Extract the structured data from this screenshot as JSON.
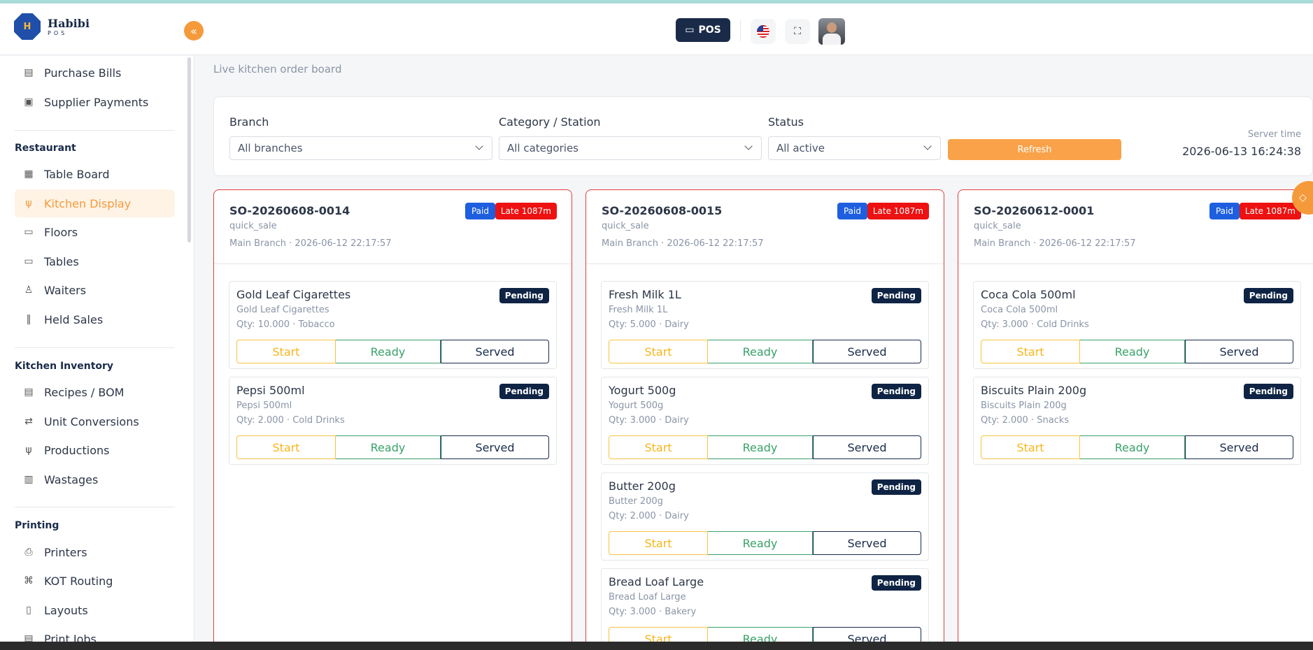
{
  "brand": {
    "logo_text": "H",
    "name": "Habibi",
    "sub": "POS"
  },
  "header": {
    "pos_label": "POS",
    "collapse_glyph": "«",
    "fullscreen_glyph": "⛶",
    "language": "English (US)"
  },
  "sidebar": {
    "items_top": [
      {
        "label": "Purchase Bills",
        "icon": "receipt-icon",
        "glyph": "▤"
      },
      {
        "label": "Supplier Payments",
        "icon": "payments-icon",
        "glyph": "▣"
      }
    ],
    "restaurant_title": "Restaurant",
    "restaurant_items": [
      {
        "label": "Table Board",
        "icon": "grid-icon",
        "glyph": "▦"
      },
      {
        "label": "Kitchen Display",
        "icon": "utensils-icon",
        "glyph": "ψ"
      },
      {
        "label": "Floors",
        "icon": "floors-icon",
        "glyph": "▭"
      },
      {
        "label": "Tables",
        "icon": "tables-icon",
        "glyph": "▭"
      },
      {
        "label": "Waiters",
        "icon": "user-icon",
        "glyph": "♙"
      },
      {
        "label": "Held Sales",
        "icon": "pause-icon",
        "glyph": "‖"
      }
    ],
    "kitchen_title": "Kitchen Inventory",
    "kitchen_items": [
      {
        "label": "Recipes / BOM",
        "icon": "clipboard-icon",
        "glyph": "▤"
      },
      {
        "label": "Unit Conversions",
        "icon": "arrows-icon",
        "glyph": "⇄"
      },
      {
        "label": "Productions",
        "icon": "utensils-icon",
        "glyph": "ψ"
      },
      {
        "label": "Wastages",
        "icon": "trash-icon",
        "glyph": "▥"
      }
    ],
    "printing_title": "Printing",
    "printing_items": [
      {
        "label": "Printers",
        "icon": "printer-icon",
        "glyph": "⎙"
      },
      {
        "label": "KOT Routing",
        "icon": "map-icon",
        "glyph": "⌘"
      },
      {
        "label": "Layouts",
        "icon": "layout-icon",
        "glyph": "▯"
      },
      {
        "label": "Print Jobs",
        "icon": "jobs-icon",
        "glyph": "▤"
      }
    ]
  },
  "page": {
    "subtitle": "Live kitchen order board"
  },
  "filters": {
    "branch_label": "Branch",
    "branch_value": "All branches",
    "category_label": "Category / Station",
    "category_value": "All categories",
    "status_label": "Status",
    "status_value": "All active",
    "refresh_label": "Refresh",
    "server_time_label": "Server time",
    "server_time_value": "2026-06-13 16:24:38"
  },
  "buttons": {
    "start": "Start",
    "ready": "Ready",
    "served": "Served"
  },
  "colors": {
    "accent": "#f59a3b",
    "navy": "#1a2b4a",
    "late": "#ee1111",
    "paid": "#1e5fe0"
  },
  "orders": [
    {
      "code": "SO-20260608-0014",
      "type": "quick_sale",
      "meta": "Main Branch · 2026-06-12 22:17:57",
      "paid": "Paid",
      "late": "Late 1087m",
      "items": [
        {
          "name": "Gold Leaf Cigarettes",
          "sub": "Gold Leaf Cigarettes",
          "qty": "Qty: 10.000 · Tobacco",
          "status": "Pending"
        },
        {
          "name": "Pepsi 500ml",
          "sub": "Pepsi 500ml",
          "qty": "Qty: 2.000 · Cold Drinks",
          "status": "Pending"
        }
      ]
    },
    {
      "code": "SO-20260608-0015",
      "type": "quick_sale",
      "meta": "Main Branch · 2026-06-12 22:17:57",
      "paid": "Paid",
      "late": "Late 1087m",
      "items": [
        {
          "name": "Fresh Milk 1L",
          "sub": "Fresh Milk 1L",
          "qty": "Qty: 5.000 · Dairy",
          "status": "Pending"
        },
        {
          "name": "Yogurt 500g",
          "sub": "Yogurt 500g",
          "qty": "Qty: 3.000 · Dairy",
          "status": "Pending"
        },
        {
          "name": "Butter 200g",
          "sub": "Butter 200g",
          "qty": "Qty: 2.000 · Dairy",
          "status": "Pending"
        },
        {
          "name": "Bread Loaf Large",
          "sub": "Bread Loaf Large",
          "qty": "Qty: 3.000 · Bakery",
          "status": "Pending"
        }
      ]
    },
    {
      "code": "SO-20260612-0001",
      "type": "quick_sale",
      "meta": "Main Branch · 2026-06-12 22:17:57",
      "paid": "Paid",
      "late": "Late 1087m",
      "items": [
        {
          "name": "Coca Cola 500ml",
          "sub": "Coca Cola 500ml",
          "qty": "Qty: 3.000 · Cold Drinks",
          "status": "Pending"
        },
        {
          "name": "Biscuits Plain 200g",
          "sub": "Biscuits Plain 200g",
          "qty": "Qty: 2.000 · Snacks",
          "status": "Pending"
        }
      ]
    }
  ]
}
